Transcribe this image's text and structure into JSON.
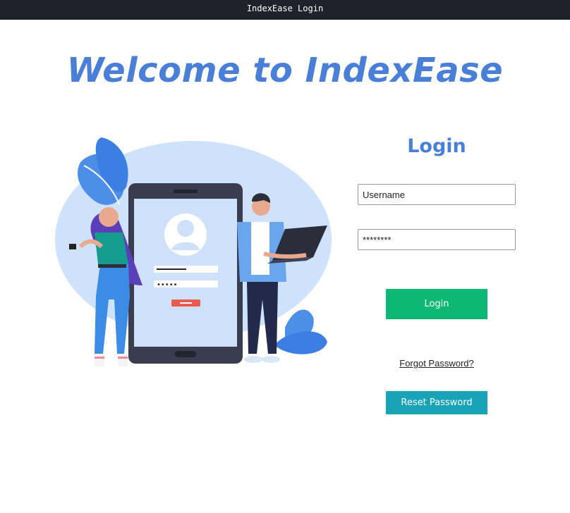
{
  "window": {
    "title": "IndexEase Login"
  },
  "header": {
    "welcome": "Welcome to IndexEase"
  },
  "login": {
    "title": "Login",
    "username_placeholder": "Username",
    "password_value": "********",
    "login_label": "Login",
    "forgot_label": "Forgot Password?",
    "reset_label": "Reset Password"
  },
  "colors": {
    "accent": "#4a7fd8",
    "login_button": "#0cb874",
    "reset_button": "#18a3b8",
    "titlebar": "#1f222a"
  },
  "illustration": {
    "phone_password_dots": "•••••"
  }
}
